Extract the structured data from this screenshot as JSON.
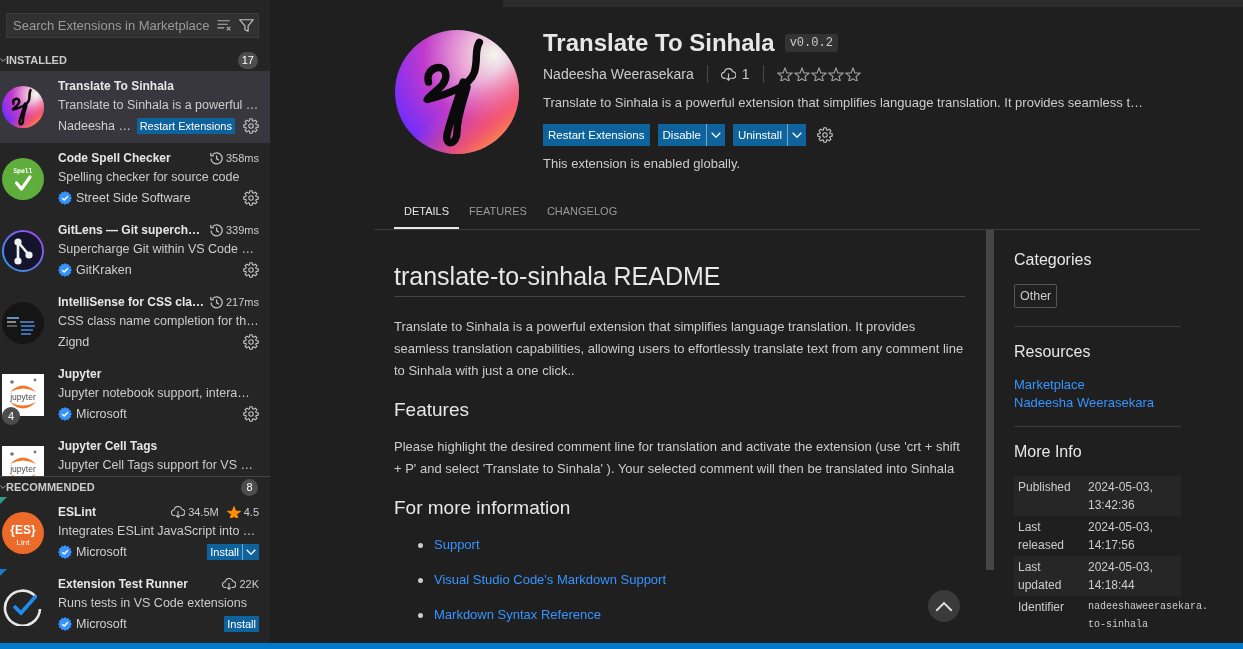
{
  "sidebar": {
    "search": {
      "placeholder": "Search Extensions in Marketplace"
    },
    "sections": [
      {
        "title": "INSTALLED",
        "count": "17",
        "expanded": true,
        "extensions": [
          {
            "name": "Translate To Sinhala",
            "description": "Translate to Sinhala is a powerful …",
            "publisher": "Nadeesha …",
            "selected": true,
            "logo": {
              "kind": "squiggle"
            },
            "buttons": [
              {
                "label": "Restart Extensions",
                "kind": "plain"
              }
            ],
            "manage": true
          },
          {
            "name": "Code Spell Checker",
            "description": "Spelling checker for source code",
            "publisher": "Street Side Software",
            "verified": true,
            "selected": false,
            "logo": {
              "kind": "spell",
              "texts": [
                "Spell"
              ]
            },
            "stats": [
              {
                "kind": "time",
                "text": "358ms"
              }
            ],
            "manage": true
          },
          {
            "name": "GitLens — Git superch…",
            "description": "Supercharge Git within VS Code …",
            "publisher": "GitKraken",
            "verified": true,
            "selected": false,
            "logo": {
              "kind": "branch"
            },
            "stats": [
              {
                "kind": "time",
                "text": "339ms"
              }
            ],
            "manage": true
          },
          {
            "name": "IntelliSense for CSS cla…",
            "description": "CSS class name completion for th…",
            "publisher": "Zignd",
            "selected": false,
            "logo": {
              "kind": "preview"
            },
            "stats": [
              {
                "kind": "time",
                "text": "217ms"
              }
            ],
            "manage": true
          },
          {
            "name": "Jupyter",
            "description": "Jupyter notebook support, intera…",
            "publisher": "Microsoft",
            "verified": true,
            "selected": false,
            "logo": {
              "kind": "jupyter",
              "texts": [
                "jupyter"
              ]
            },
            "badge": "4",
            "manage": true
          },
          {
            "name": "Jupyter Cell Tags",
            "description": "Jupyter Cell Tags support for VS …",
            "selected": false,
            "logo": {
              "kind": "jupyter",
              "texts": [
                "jupyter"
              ]
            }
          }
        ]
      },
      {
        "title": "RECOMMENDED",
        "count": "8",
        "expanded": true,
        "extensions": [
          {
            "name": "ESLint",
            "description": "Integrates ESLint JavaScript into …",
            "publisher": "Microsoft",
            "verified": true,
            "selected": false,
            "color": "#2e9c8a",
            "logo": {
              "kind": "eslint",
              "texts": [
                "{ES}",
                "Lint"
              ]
            },
            "stats": [
              {
                "kind": "downloads",
                "text": "34.5M"
              },
              {
                "kind": "rating",
                "text": "4.5"
              }
            ],
            "buttons": [
              {
                "label": "Install",
                "kind": "split"
              }
            ]
          },
          {
            "name": "Extension Test Runner",
            "description": "Runs tests in VS Code extensions",
            "publisher": "Microsoft",
            "verified": true,
            "selected": false,
            "color": "#1f78c8",
            "logo": {
              "kind": "check-ring"
            },
            "stats": [
              {
                "kind": "downloads",
                "text": "22K"
              }
            ],
            "buttons": [
              {
                "label": "Install",
                "kind": "plain"
              }
            ]
          }
        ]
      }
    ]
  },
  "details": {
    "logo": {
      "kind": "squiggle"
    },
    "name": "Translate To Sinhala",
    "version": "v0.0.2",
    "publisher": "Nadeesha Weerasekara",
    "installs": "1",
    "stars": 0,
    "description": "Translate to Sinhala is a powerful extension that simplifies language translation. It provides seamless t…",
    "buttons": [
      {
        "label": "Restart Extensions",
        "kind": "plain"
      },
      {
        "label": "Disable",
        "kind": "split"
      },
      {
        "label": "Uninstall",
        "kind": "split"
      }
    ],
    "manage": true,
    "status": "This extension is enabled globally.",
    "tabs": [
      {
        "label": "DETAILS",
        "selected": true
      },
      {
        "label": "FEATURES",
        "selected": false
      },
      {
        "label": "CHANGELOG",
        "selected": false
      }
    ]
  },
  "readme": [
    {
      "kind": "h1",
      "text": "translate-to-sinhala README"
    },
    {
      "kind": "p",
      "text": "Translate to Sinhala is a powerful extension that simplifies language translation. It provides seamless translation capabilities, allowing users to effortlessly translate text from any comment line to Sinhala with just a one click.."
    },
    {
      "kind": "h2",
      "text": "Features"
    },
    {
      "kind": "p",
      "text": "Please highlight the desired comment line for translation and activate the extension (use 'crt + shift + P' and select 'Translate to Sinhala' ). Your selected comment will then be translated into Sinhala"
    },
    {
      "kind": "h2",
      "text": "For more information"
    },
    {
      "kind": "links",
      "items": [
        "Support",
        "Visual Studio Code's Markdown Support",
        "Markdown Syntax Reference"
      ]
    }
  ],
  "side_panel": [
    {
      "kind": "tags",
      "title": "Categories",
      "items": [
        "Other"
      ]
    },
    {
      "kind": "links",
      "title": "Resources",
      "items": [
        "Marketplace",
        "Nadeesha Weerasekara"
      ]
    },
    {
      "kind": "table",
      "title": "More Info",
      "rows": [
        {
          "label": "Published",
          "value": "2024-05-03, 13:42:36",
          "kind": "text"
        },
        {
          "label": "Last released",
          "value": "2024-05-03, 14:17:56",
          "kind": "text"
        },
        {
          "label": "Last updated",
          "value": "2024-05-03, 14:18:44",
          "kind": "text"
        },
        {
          "label": "Identifier",
          "value": "nadeeshaweerasekara.to-sinhala",
          "kind": "code"
        }
      ]
    }
  ]
}
